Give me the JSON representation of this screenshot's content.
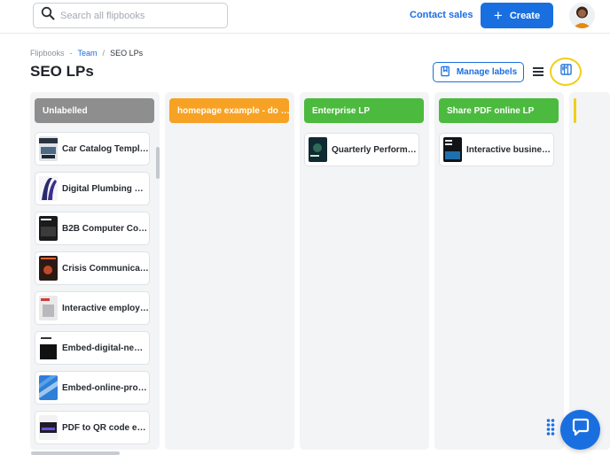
{
  "header": {
    "search_placeholder": "Search all flipbooks",
    "contact_sales": "Contact sales",
    "create_label": "Create"
  },
  "breadcrumb": {
    "root": "Flipbooks",
    "team": "Team",
    "current": "SEO LPs"
  },
  "page": {
    "title": "SEO LPs",
    "manage_labels": "Manage labels"
  },
  "columns": [
    {
      "title": "Unlabelled",
      "color": "#8e8e8e",
      "cards": [
        {
          "title": "Car Catalog Templ…",
          "thumb": "#3a4a5a"
        },
        {
          "title": "Digital Plumbing S…",
          "thumb": "#2b2a6e"
        },
        {
          "title": "B2B Computer Co…",
          "thumb": "#1b1b1b"
        },
        {
          "title": "Crisis Communica…",
          "thumb": "#2a1a14"
        },
        {
          "title": "Interactive employ…",
          "thumb": "#e9e9ea"
        },
        {
          "title": "Embed-digital-new…",
          "thumb": "#111111"
        },
        {
          "title": "Embed-online-pros…",
          "thumb": "#2f7fd6"
        },
        {
          "title": "PDF to QR code e…",
          "thumb": "#1c1c28"
        }
      ]
    },
    {
      "title": "homepage example - do …",
      "color": "#f7a224",
      "cards": []
    },
    {
      "title": "Enterprise LP",
      "color": "#4cba3f",
      "cards": [
        {
          "title": "Quarterly Perform…",
          "thumb": "#0f2a30"
        }
      ]
    },
    {
      "title": "Share PDF online LP",
      "color": "#4cba3f",
      "cards": [
        {
          "title": "Interactive busines…",
          "thumb": "#101418"
        }
      ]
    }
  ],
  "colors": {
    "accent": "#1a6fe0",
    "highlight_ring": "#f0cf1a",
    "next_column_accent": "#f0cf1a"
  },
  "icons": [
    "search-icon",
    "plus-icon",
    "bookmark-icon",
    "list-view-icon",
    "board-view-icon",
    "drag-handle-icon",
    "chat-icon"
  ]
}
